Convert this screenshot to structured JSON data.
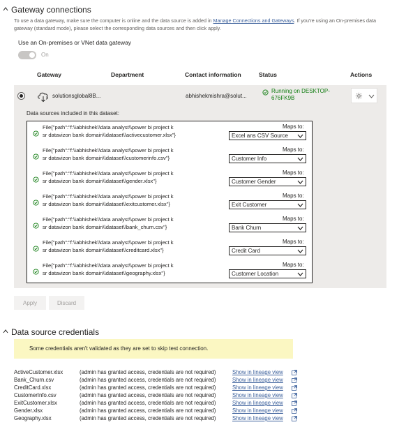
{
  "gateway": {
    "title": "Gateway connections",
    "description_pre": "To use a data gateway, make sure the computer is online and the data source is added in ",
    "description_link": "Manage Connections and Gateways",
    "description_post": ". If you're using an On-premises data gateway (standard mode), please select the corresponding data sources and then click apply.",
    "toggle_label": "Use an On-premises or VNet data gateway",
    "toggle_state": "On",
    "columns": [
      "Gateway",
      "Department",
      "Contact information",
      "Status",
      "Actions"
    ],
    "row": {
      "name": "solutionsglobal8B...",
      "department": "",
      "contact": "abhishekmishra@solut...",
      "status_line1": "Running on DESKTOP-",
      "status_line2": "676FK9B",
      "status_color": "#107c10"
    }
  },
  "data_sources": {
    "heading": "Data sources included in this dataset:",
    "maps_to_label": "Maps to:",
    "items": [
      {
        "line1": "File{\"path\":\"f:\\\\abhishek\\\\data analyst\\\\power bi project k",
        "line2": "sr datavizon bank domain\\\\dataset\\\\activecustomer.xlsx\"}",
        "maps_to": "Excel ans CSV Source"
      },
      {
        "line1": "File{\"path\":\"f:\\\\abhishek\\\\data analyst\\\\power bi project k",
        "line2": "sr datavizon bank domain\\\\dataset\\\\customerinfo.csv\"}",
        "maps_to": "Customer Info"
      },
      {
        "line1": "File{\"path\":\"f:\\\\abhishek\\\\data analyst\\\\power bi project k",
        "line2": "sr datavizon bank domain\\\\dataset\\\\gender.xlsx\"}",
        "maps_to": "Customer Gender"
      },
      {
        "line1": "File{\"path\":\"f:\\\\abhishek\\\\data analyst\\\\power bi project k",
        "line2": "sr datavizon bank domain\\\\dataset\\\\exitcustomer.xlsx\"}",
        "maps_to": "Exit Customer"
      },
      {
        "line1": "File{\"path\":\"f:\\\\abhishek\\\\data analyst\\\\power bi project k",
        "line2": "sr datavizon bank domain\\\\dataset\\\\bank_churn.csv\"}",
        "maps_to": "Bank Churn"
      },
      {
        "line1": "File{\"path\":\"f:\\\\abhishek\\\\data analyst\\\\power bi project k",
        "line2": "sr datavizon bank domain\\\\dataset\\\\creditcard.xlsx\"}",
        "maps_to": "Credit Card"
      },
      {
        "line1": "File{\"path\":\"f:\\\\abhishek\\\\data analyst\\\\power bi project k",
        "line2": "sr datavizon bank domain\\\\dataset\\\\geography.xlsx\"}",
        "maps_to": "Customer Location"
      }
    ]
  },
  "buttons": {
    "apply": "Apply",
    "discard": "Discard"
  },
  "credentials": {
    "title": "Data source credentials",
    "warning": "Some credentials aren't validated as they are set to skip test connection.",
    "warning_bg": "#fbf7c2",
    "rows": [
      {
        "file": "ActiveCustomer.xlsx",
        "message": "(admin has granted access, credentials are not required)",
        "link": "Show in lineage view"
      },
      {
        "file": "Bank_Churn.csv",
        "message": "(admin has granted access, credentials are not required)",
        "link": "Show in lineage view"
      },
      {
        "file": "CreditCard.xlsx",
        "message": "(admin has granted access, credentials are not required)",
        "link": "Show in lineage view"
      },
      {
        "file": "CustomerInfo.csv",
        "message": "(admin has granted access, credentials are not required)",
        "link": "Show in lineage view"
      },
      {
        "file": "ExitCustomer.xlsx",
        "message": "(admin has granted access, credentials are not required)",
        "link": "Show in lineage view"
      },
      {
        "file": "Gender.xlsx",
        "message": "(admin has granted access, credentials are not required)",
        "link": "Show in lineage view"
      },
      {
        "file": "Geography.xlsx",
        "message": "(admin has granted access, credentials are not required)",
        "link": "Show in lineage view"
      }
    ]
  },
  "link_color": "#3a5f9b"
}
